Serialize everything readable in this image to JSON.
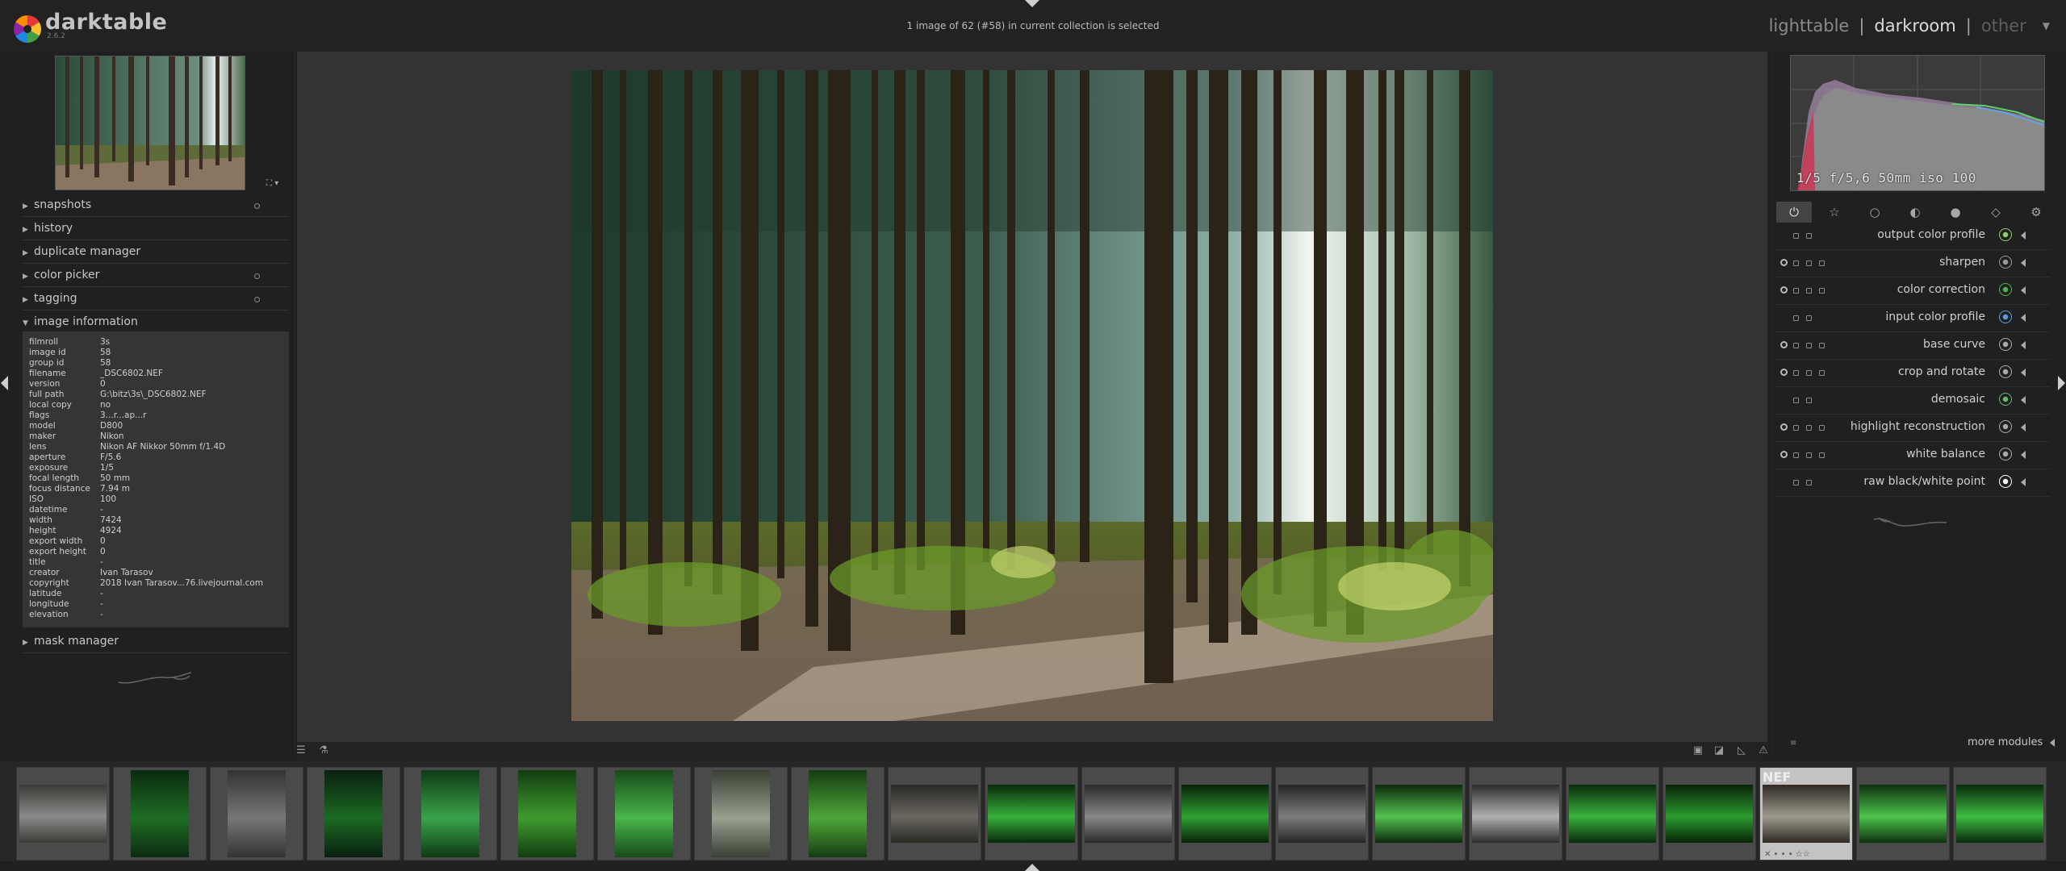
{
  "header": {
    "app_name": "darktable",
    "app_version": "2.6.2",
    "status": "1 image of 62 (#58) in current collection is selected",
    "views": {
      "lighttable": "lighttable",
      "darkroom": "darkroom",
      "other": "other",
      "sep": "|"
    }
  },
  "navigation": {
    "zoom_icon": "expand-icon",
    "zoom_menu": "▾"
  },
  "left_modules": {
    "snapshots": "snapshots",
    "history": "history",
    "duplicate_manager": "duplicate manager",
    "color_picker": "color picker",
    "tagging": "tagging",
    "image_information": "image information",
    "mask_manager": "mask manager"
  },
  "image_info": [
    {
      "k": "filmroll",
      "v": "3s"
    },
    {
      "k": "image id",
      "v": "58"
    },
    {
      "k": "group id",
      "v": "58"
    },
    {
      "k": "filename",
      "v": "_DSC6802.NEF"
    },
    {
      "k": "version",
      "v": "0"
    },
    {
      "k": "full path",
      "v": "G:\\bitz\\3s\\_DSC6802.NEF"
    },
    {
      "k": "local copy",
      "v": "no"
    },
    {
      "k": "flags",
      "v": "3...r...ap...r"
    },
    {
      "k": "model",
      "v": "D800"
    },
    {
      "k": "maker",
      "v": "Nikon"
    },
    {
      "k": "lens",
      "v": "Nikon AF Nikkor 50mm f/1.4D"
    },
    {
      "k": "aperture",
      "v": "F/5.6"
    },
    {
      "k": "exposure",
      "v": "1/5"
    },
    {
      "k": "focal length",
      "v": "50 mm"
    },
    {
      "k": "focus distance",
      "v": "7.94 m"
    },
    {
      "k": "ISO",
      "v": "100"
    },
    {
      "k": "datetime",
      "v": "-"
    },
    {
      "k": "width",
      "v": "7424"
    },
    {
      "k": "height",
      "v": "4924"
    },
    {
      "k": "export width",
      "v": "0"
    },
    {
      "k": "export height",
      "v": "0"
    },
    {
      "k": "title",
      "v": "-"
    },
    {
      "k": "creator",
      "v": "Ivan Tarasov"
    },
    {
      "k": "copyright",
      "v": "2018 Ivan Tarasov...76.livejournal.com"
    },
    {
      "k": "latitude",
      "v": "-"
    },
    {
      "k": "longitude",
      "v": "-"
    },
    {
      "k": "elevation",
      "v": "-"
    }
  ],
  "histogram": {
    "info": "1/5 f/5,6 50mm iso 100"
  },
  "module_groups": [
    {
      "name": "power-icon",
      "glyph": "⏻"
    },
    {
      "name": "star-icon",
      "glyph": "☆"
    },
    {
      "name": "circle-icon",
      "glyph": "○"
    },
    {
      "name": "tone-icon",
      "glyph": "◐"
    },
    {
      "name": "color-icon",
      "glyph": "●"
    },
    {
      "name": "correct-icon",
      "glyph": "◇"
    },
    {
      "name": "effect-icon",
      "glyph": "⚙"
    }
  ],
  "modules": [
    {
      "label": "output color profile",
      "name": "module-output-color-profile",
      "icon_color": "#8bd06b",
      "power": false
    },
    {
      "label": "sharpen",
      "name": "module-sharpen",
      "icon_color": "#9a9a9a",
      "power": true
    },
    {
      "label": "color correction",
      "name": "module-color-correction",
      "icon_color": "#4caf50",
      "power": true
    },
    {
      "label": "input color profile",
      "name": "module-input-color-profile",
      "icon_color": "#5aa0e0",
      "power": false
    },
    {
      "label": "base curve",
      "name": "module-base-curve",
      "icon_color": "#aaaaaa",
      "power": true
    },
    {
      "label": "crop and rotate",
      "name": "module-crop-and-rotate",
      "icon_color": "#aaaaaa",
      "power": true
    },
    {
      "label": "demosaic",
      "name": "module-demosaic",
      "icon_color": "#66bb6a",
      "power": false
    },
    {
      "label": "highlight reconstruction",
      "name": "module-highlight-reconstruction",
      "icon_color": "#aaaaaa",
      "power": true
    },
    {
      "label": "white balance",
      "name": "module-white-balance",
      "icon_color": "#aaaaaa",
      "power": true
    },
    {
      "label": "raw black/white point",
      "name": "module-raw-black-white-point",
      "icon_color": "#ffffff",
      "power": false
    }
  ],
  "more_modules": "more modules",
  "filmstrip": {
    "selected_index": 18,
    "selected_badge": "NEF",
    "stars": "✕ • • • ☆☆",
    "thumbs": [
      {
        "c1": "#8a8a8a",
        "c2": "#3a3a36",
        "w": 108
      },
      {
        "c1": "#1f6e24",
        "c2": "#0b2a10",
        "w": 72
      },
      {
        "c1": "#777",
        "c2": "#333",
        "w": 72
      },
      {
        "c1": "#1b6a22",
        "c2": "#0a2010",
        "w": 72
      },
      {
        "c1": "#3aa34a",
        "c2": "#0e3a16",
        "w": 72
      },
      {
        "c1": "#3e9a2e",
        "c2": "#123d10",
        "w": 72
      },
      {
        "c1": "#49b64a",
        "c2": "#174a1a",
        "w": 72
      },
      {
        "c1": "#9aa090",
        "c2": "#3a4032",
        "w": 72
      },
      {
        "c1": "#4ea73a",
        "c2": "#163c12",
        "w": 72
      },
      {
        "c1": "#6a6860",
        "c2": "#2a2824",
        "w": 108
      },
      {
        "c1": "#37b03a",
        "c2": "#0a2a0c",
        "w": 108
      },
      {
        "c1": "#888",
        "c2": "#2a2a2a",
        "w": 108
      },
      {
        "c1": "#2fa032",
        "c2": "#082208",
        "w": 108
      },
      {
        "c1": "#7d7d7d",
        "c2": "#252525",
        "w": 108
      },
      {
        "c1": "#53c04f",
        "c2": "#0b2a0c",
        "w": 108
      },
      {
        "c1": "#b0b0b0",
        "c2": "#2c2c2c",
        "w": 108
      },
      {
        "c1": "#39b23c",
        "c2": "#0a2a0c",
        "w": 108
      },
      {
        "c1": "#2b9b2f",
        "c2": "#072407",
        "w": 108
      },
      {
        "c1": "#9e9a8e",
        "c2": "#2f2a22",
        "w": 108
      },
      {
        "c1": "#4cc44a",
        "c2": "#0e3010",
        "w": 108
      },
      {
        "c1": "#3dbb40",
        "c2": "#0a2a0c",
        "w": 108
      }
    ]
  }
}
